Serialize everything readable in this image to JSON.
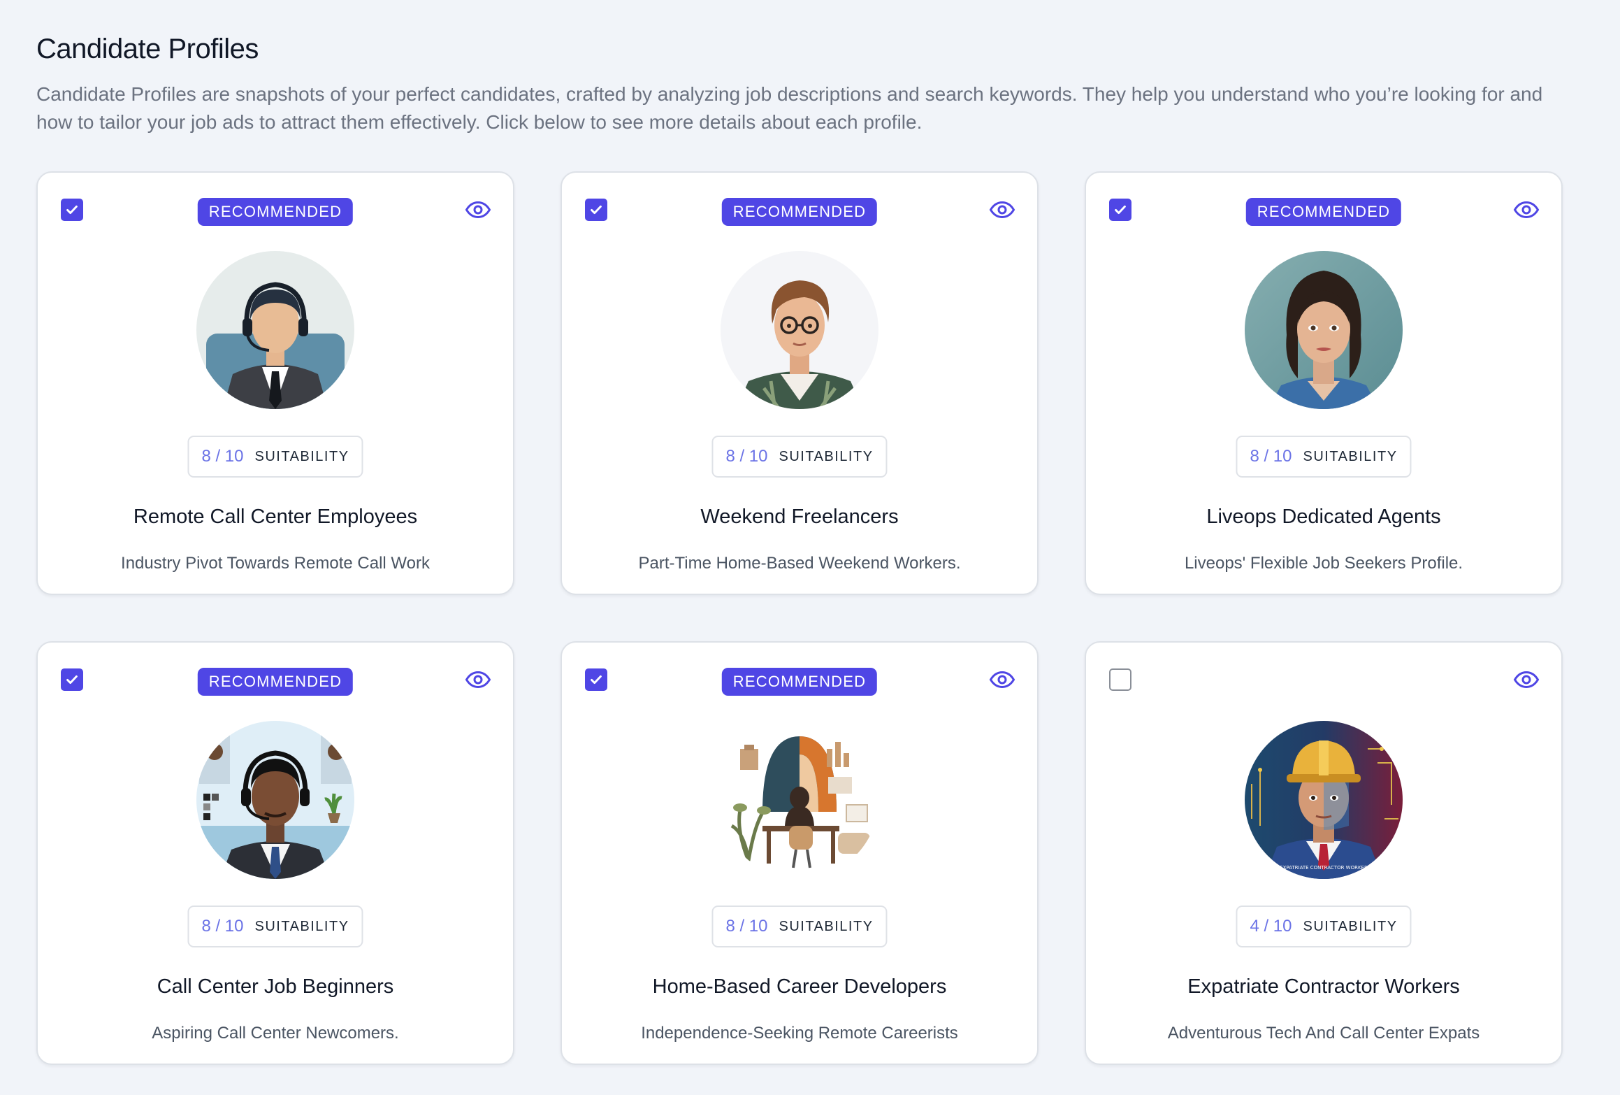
{
  "header": {
    "title": "Candidate Profiles",
    "description": "Candidate Profiles are snapshots of your perfect candidates, crafted by analyzing job descriptions and search keywords. They help you understand who you’re looking for and how to tailor your job ads to attract them effectively. Click below to see more details about each profile."
  },
  "colors": {
    "accent": "#4f46e5",
    "score": "#6b73e6",
    "background": "#f1f4f9"
  },
  "cards": [
    {
      "checked": true,
      "badge": "RECOMMENDED",
      "score": "8 / 10",
      "suitability_label": "SUITABILITY",
      "title": "Remote Call Center Employees",
      "subtitle": "Industry Pivot Towards Remote Call Work",
      "avatar_icon": "call-center-agent-avatar-icon"
    },
    {
      "checked": true,
      "badge": "RECOMMENDED",
      "score": "8 / 10",
      "suitability_label": "SUITABILITY",
      "title": "Weekend Freelancers",
      "subtitle": "Part-Time Home-Based Weekend Workers.",
      "avatar_icon": "freelancer-with-glasses-avatar-icon"
    },
    {
      "checked": true,
      "badge": "RECOMMENDED",
      "score": "8 / 10",
      "suitability_label": "SUITABILITY",
      "title": "Liveops Dedicated Agents",
      "subtitle": "Liveops' Flexible Job Seekers Profile.",
      "avatar_icon": "woman-agent-avatar-icon"
    },
    {
      "checked": true,
      "badge": "RECOMMENDED",
      "score": "8 / 10",
      "suitability_label": "SUITABILITY",
      "title": "Call Center Job Beginners",
      "subtitle": "Aspiring Call Center Newcomers.",
      "avatar_icon": "headset-beginner-avatar-icon"
    },
    {
      "checked": true,
      "badge": "RECOMMENDED",
      "score": "8 / 10",
      "suitability_label": "SUITABILITY",
      "title": "Home-Based Career Developers",
      "subtitle": "Independence-Seeking Remote Careerists",
      "avatar_icon": "home-office-illustration-icon"
    },
    {
      "checked": false,
      "badge": "",
      "score": "4 / 10",
      "suitability_label": "SUITABILITY",
      "title": "Expatriate Contractor Workers",
      "subtitle": "Adventurous Tech And Call Center Expats",
      "avatar_icon": "contractor-hardhat-avatar-icon",
      "avatar_caption": "EXPATRIATE CONTRACTOR WORKER"
    }
  ]
}
